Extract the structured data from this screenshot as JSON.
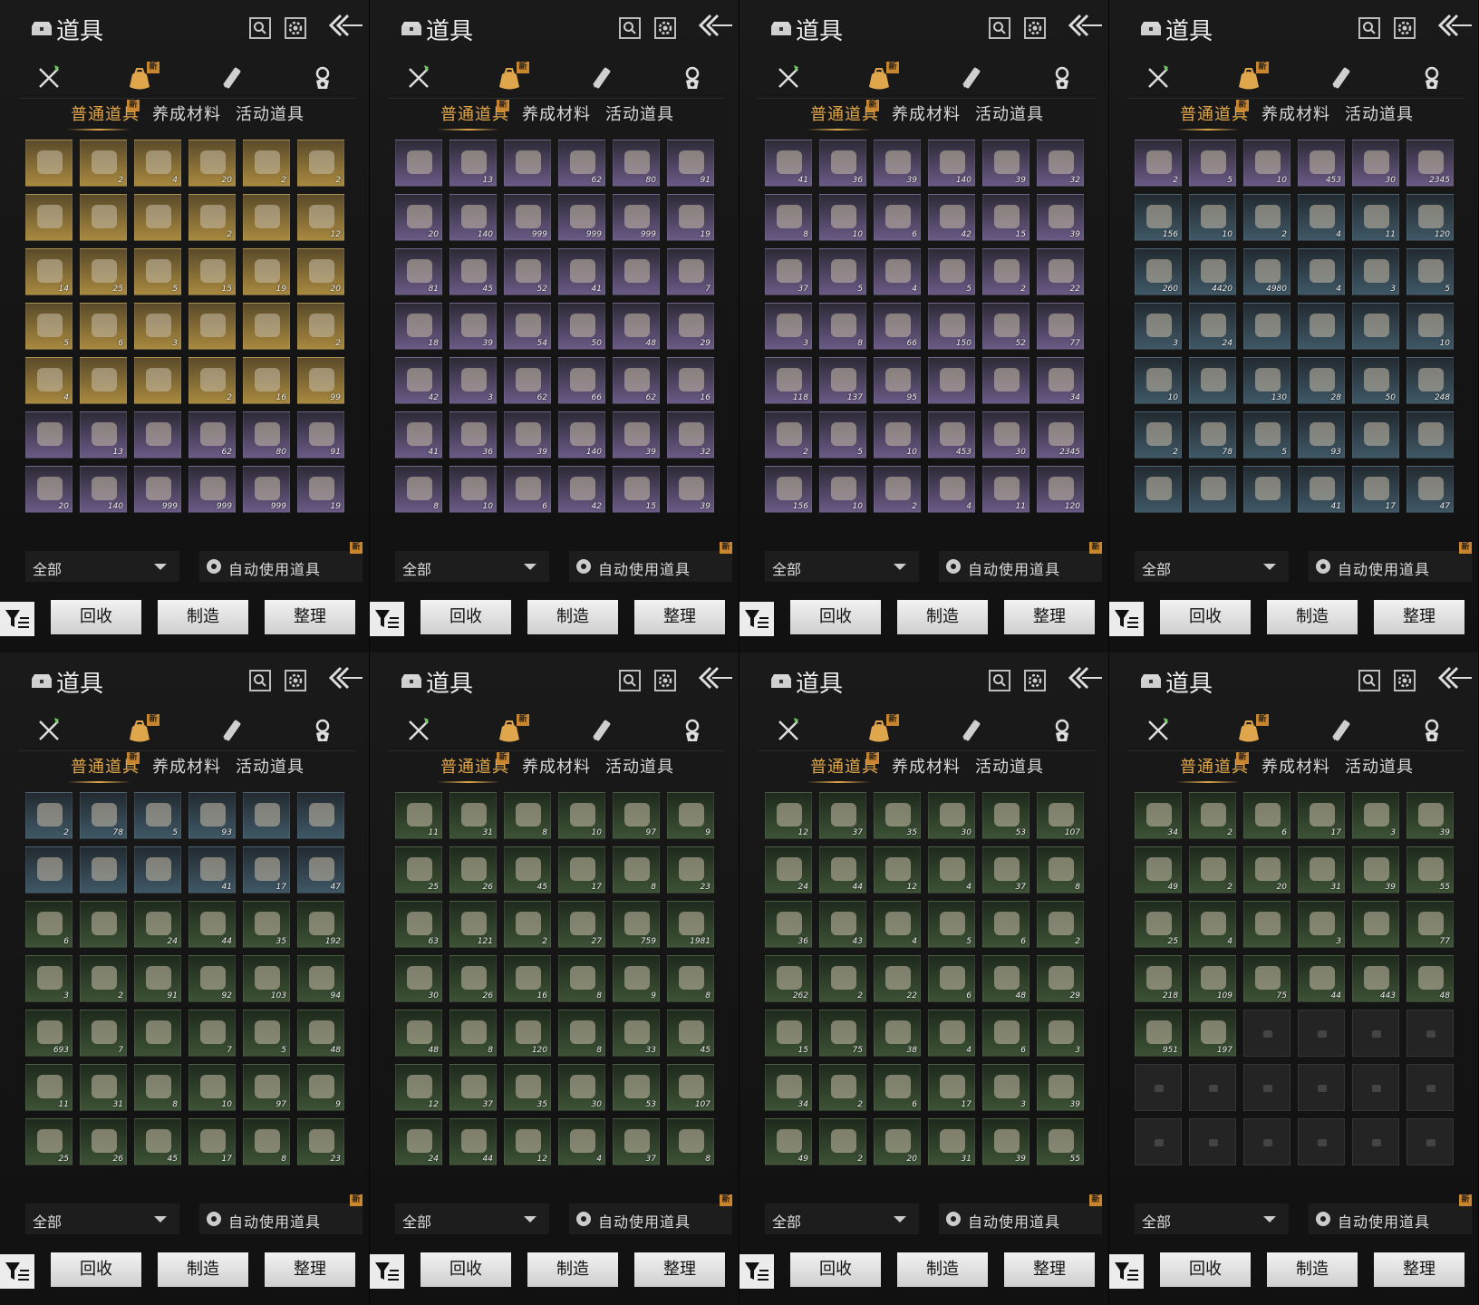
{
  "header": {
    "title": "道具"
  },
  "tabs": [
    {
      "label": "普通道具",
      "badge": "新"
    },
    {
      "label": "养成材料"
    },
    {
      "label": "活动道具"
    }
  ],
  "category_badge": "新",
  "filter": {
    "selected": "全部"
  },
  "auto_use": {
    "label": "自动使用道具",
    "badge": "新"
  },
  "buttons": {
    "recycle": "回收",
    "craft": "制造",
    "sort": "整理"
  },
  "icons": [
    "chest-icon",
    "search-icon",
    "gear-icon",
    "back-arrow-icon",
    "weapon-icon",
    "item-bag-icon",
    "scroll-icon",
    "dungeon-icon",
    "funnel-icon"
  ],
  "panels": [
    {
      "slots": [
        [
          "gold",
          ""
        ],
        [
          "gold",
          "2"
        ],
        [
          "gold",
          "4"
        ],
        [
          "gold",
          "20"
        ],
        [
          "gold",
          "2"
        ],
        [
          "gold",
          "2"
        ],
        [
          "gold",
          ""
        ],
        [
          "gold",
          ""
        ],
        [
          "gold",
          ""
        ],
        [
          "gold",
          "2"
        ],
        [
          "gold",
          ""
        ],
        [
          "gold",
          "12"
        ],
        [
          "gold",
          "14"
        ],
        [
          "gold",
          "25"
        ],
        [
          "gold",
          "5"
        ],
        [
          "gold",
          "15"
        ],
        [
          "gold",
          "19"
        ],
        [
          "gold",
          "20"
        ],
        [
          "gold",
          "5"
        ],
        [
          "gold",
          "6"
        ],
        [
          "gold",
          "3"
        ],
        [
          "gold",
          ""
        ],
        [
          "gold",
          ""
        ],
        [
          "gold",
          "2"
        ],
        [
          "gold",
          "4"
        ],
        [
          "gold",
          ""
        ],
        [
          "gold",
          ""
        ],
        [
          "gold",
          "2"
        ],
        [
          "gold",
          "16"
        ],
        [
          "gold",
          "99"
        ],
        [
          "purple",
          ""
        ],
        [
          "purple",
          "13"
        ],
        [
          "purple",
          ""
        ],
        [
          "purple",
          "62"
        ],
        [
          "purple",
          "80"
        ],
        [
          "purple",
          "91"
        ],
        [
          "purple",
          "20"
        ],
        [
          "purple",
          "140"
        ],
        [
          "purple",
          "999"
        ],
        [
          "purple",
          "999"
        ],
        [
          "purple",
          "999"
        ],
        [
          "purple",
          "19"
        ]
      ]
    },
    {
      "slots": [
        [
          "purple",
          ""
        ],
        [
          "purple",
          "13"
        ],
        [
          "purple",
          ""
        ],
        [
          "purple",
          "62"
        ],
        [
          "purple",
          "80"
        ],
        [
          "purple",
          "91"
        ],
        [
          "purple",
          "20"
        ],
        [
          "purple",
          "140"
        ],
        [
          "purple",
          "999"
        ],
        [
          "purple",
          "999"
        ],
        [
          "purple",
          "999"
        ],
        [
          "purple",
          "19"
        ],
        [
          "purple",
          "81"
        ],
        [
          "purple",
          "45"
        ],
        [
          "purple",
          "52"
        ],
        [
          "purple",
          "41"
        ],
        [
          "purple",
          ""
        ],
        [
          "purple",
          "7"
        ],
        [
          "purple",
          "18"
        ],
        [
          "purple",
          "39"
        ],
        [
          "purple",
          "54"
        ],
        [
          "purple",
          "50"
        ],
        [
          "purple",
          "48"
        ],
        [
          "purple",
          "29"
        ],
        [
          "purple",
          "42"
        ],
        [
          "purple",
          "3"
        ],
        [
          "purple",
          "62"
        ],
        [
          "purple",
          "66"
        ],
        [
          "purple",
          "62"
        ],
        [
          "purple",
          "16"
        ],
        [
          "purple",
          "41"
        ],
        [
          "purple",
          "36"
        ],
        [
          "purple",
          "39"
        ],
        [
          "purple",
          "140"
        ],
        [
          "purple",
          "39"
        ],
        [
          "purple",
          "32"
        ],
        [
          "purple",
          "8"
        ],
        [
          "purple",
          "10"
        ],
        [
          "purple",
          "6"
        ],
        [
          "purple",
          "42"
        ],
        [
          "purple",
          "15"
        ],
        [
          "purple",
          "39"
        ]
      ]
    },
    {
      "slots": [
        [
          "purple",
          "41"
        ],
        [
          "purple",
          "36"
        ],
        [
          "purple",
          "39"
        ],
        [
          "purple",
          "140"
        ],
        [
          "purple",
          "39"
        ],
        [
          "purple",
          "32"
        ],
        [
          "purple",
          "8"
        ],
        [
          "purple",
          "10"
        ],
        [
          "purple",
          "6"
        ],
        [
          "purple",
          "42"
        ],
        [
          "purple",
          "15"
        ],
        [
          "purple",
          "39"
        ],
        [
          "purple",
          "37"
        ],
        [
          "purple",
          "5"
        ],
        [
          "purple",
          "4"
        ],
        [
          "purple",
          "5"
        ],
        [
          "purple",
          "2"
        ],
        [
          "purple",
          "22"
        ],
        [
          "purple",
          "3"
        ],
        [
          "purple",
          "8"
        ],
        [
          "purple",
          "66"
        ],
        [
          "purple",
          "150"
        ],
        [
          "purple",
          "52"
        ],
        [
          "purple",
          "77"
        ],
        [
          "purple",
          "118"
        ],
        [
          "purple",
          "137"
        ],
        [
          "purple",
          "95"
        ],
        [
          "purple",
          ""
        ],
        [
          "purple",
          ""
        ],
        [
          "purple",
          "34"
        ],
        [
          "purple",
          "2"
        ],
        [
          "purple",
          "5"
        ],
        [
          "purple",
          "10"
        ],
        [
          "purple",
          "453"
        ],
        [
          "purple",
          "30"
        ],
        [
          "purple",
          "2345"
        ],
        [
          "purple",
          "156"
        ],
        [
          "purple",
          "10"
        ],
        [
          "purple",
          "2"
        ],
        [
          "purple",
          "4"
        ],
        [
          "purple",
          "11"
        ],
        [
          "purple",
          "120"
        ]
      ]
    },
    {
      "slots": [
        [
          "purple",
          "2"
        ],
        [
          "purple",
          "5"
        ],
        [
          "purple",
          "10"
        ],
        [
          "purple",
          "453"
        ],
        [
          "purple",
          "30"
        ],
        [
          "purple",
          "2345"
        ],
        [
          "blue",
          "156"
        ],
        [
          "blue",
          "10"
        ],
        [
          "blue",
          "2"
        ],
        [
          "blue",
          "4"
        ],
        [
          "blue",
          "11"
        ],
        [
          "blue",
          "120"
        ],
        [
          "blue",
          "260"
        ],
        [
          "blue",
          "4420"
        ],
        [
          "blue",
          "4980"
        ],
        [
          "blue",
          "4"
        ],
        [
          "blue",
          "3"
        ],
        [
          "blue",
          "5"
        ],
        [
          "blue",
          "3"
        ],
        [
          "blue",
          "24"
        ],
        [
          "blue",
          ""
        ],
        [
          "blue",
          ""
        ],
        [
          "blue",
          ""
        ],
        [
          "blue",
          "10"
        ],
        [
          "blue",
          "10"
        ],
        [
          "blue",
          ""
        ],
        [
          "blue",
          "130"
        ],
        [
          "blue",
          "28"
        ],
        [
          "blue",
          "50"
        ],
        [
          "blue",
          "248"
        ],
        [
          "blue",
          "2"
        ],
        [
          "blue",
          "78"
        ],
        [
          "blue",
          "5"
        ],
        [
          "blue",
          "93"
        ],
        [
          "blue",
          ""
        ],
        [
          "blue",
          ""
        ],
        [
          "blue",
          ""
        ],
        [
          "blue",
          ""
        ],
        [
          "blue",
          ""
        ],
        [
          "blue",
          "41"
        ],
        [
          "blue",
          "17"
        ],
        [
          "blue",
          "47"
        ]
      ]
    },
    {
      "slots": [
        [
          "blue",
          "2"
        ],
        [
          "blue",
          "78"
        ],
        [
          "blue",
          "5"
        ],
        [
          "blue",
          "93"
        ],
        [
          "blue",
          ""
        ],
        [
          "blue",
          ""
        ],
        [
          "blue",
          ""
        ],
        [
          "blue",
          ""
        ],
        [
          "blue",
          ""
        ],
        [
          "blue",
          "41"
        ],
        [
          "blue",
          "17"
        ],
        [
          "blue",
          "47"
        ],
        [
          "green",
          "6"
        ],
        [
          "green",
          ""
        ],
        [
          "green",
          "24"
        ],
        [
          "green",
          "44"
        ],
        [
          "green",
          "35"
        ],
        [
          "green",
          "192"
        ],
        [
          "green",
          "3"
        ],
        [
          "green",
          "2"
        ],
        [
          "green",
          "91"
        ],
        [
          "green",
          "92"
        ],
        [
          "green",
          "103"
        ],
        [
          "green",
          "94"
        ],
        [
          "green",
          "693"
        ],
        [
          "green",
          "7"
        ],
        [
          "green",
          ""
        ],
        [
          "green",
          "7"
        ],
        [
          "green",
          "5"
        ],
        [
          "green",
          "48"
        ],
        [
          "green",
          "11"
        ],
        [
          "green",
          "31"
        ],
        [
          "green",
          "8"
        ],
        [
          "green",
          "10"
        ],
        [
          "green",
          "97"
        ],
        [
          "green",
          "9"
        ],
        [
          "green",
          "25"
        ],
        [
          "green",
          "26"
        ],
        [
          "green",
          "45"
        ],
        [
          "green",
          "17"
        ],
        [
          "green",
          "8"
        ],
        [
          "green",
          "23"
        ]
      ]
    },
    {
      "slots": [
        [
          "green",
          "11"
        ],
        [
          "green",
          "31"
        ],
        [
          "green",
          "8"
        ],
        [
          "green",
          "10"
        ],
        [
          "green",
          "97"
        ],
        [
          "green",
          "9"
        ],
        [
          "green",
          "25"
        ],
        [
          "green",
          "26"
        ],
        [
          "green",
          "45"
        ],
        [
          "green",
          "17"
        ],
        [
          "green",
          "8"
        ],
        [
          "green",
          "23"
        ],
        [
          "green",
          "63"
        ],
        [
          "green",
          "121"
        ],
        [
          "green",
          "2"
        ],
        [
          "green",
          "27"
        ],
        [
          "green",
          "759"
        ],
        [
          "green",
          "1981"
        ],
        [
          "green",
          "30"
        ],
        [
          "green",
          "26"
        ],
        [
          "green",
          "16"
        ],
        [
          "green",
          "8"
        ],
        [
          "green",
          "9"
        ],
        [
          "green",
          "8"
        ],
        [
          "green",
          "48"
        ],
        [
          "green",
          "8"
        ],
        [
          "green",
          "120"
        ],
        [
          "green",
          "8"
        ],
        [
          "green",
          "33"
        ],
        [
          "green",
          "45"
        ],
        [
          "green",
          "12"
        ],
        [
          "green",
          "37"
        ],
        [
          "green",
          "35"
        ],
        [
          "green",
          "30"
        ],
        [
          "green",
          "53"
        ],
        [
          "green",
          "107"
        ],
        [
          "green",
          "24"
        ],
        [
          "green",
          "44"
        ],
        [
          "green",
          "12"
        ],
        [
          "green",
          "4"
        ],
        [
          "green",
          "37"
        ],
        [
          "green",
          "8"
        ]
      ]
    },
    {
      "slots": [
        [
          "green",
          "12"
        ],
        [
          "green",
          "37"
        ],
        [
          "green",
          "35"
        ],
        [
          "green",
          "30"
        ],
        [
          "green",
          "53"
        ],
        [
          "green",
          "107"
        ],
        [
          "green",
          "24"
        ],
        [
          "green",
          "44"
        ],
        [
          "green",
          "12"
        ],
        [
          "green",
          "4"
        ],
        [
          "green",
          "37"
        ],
        [
          "green",
          "8"
        ],
        [
          "green",
          "36"
        ],
        [
          "green",
          "43"
        ],
        [
          "green",
          "4"
        ],
        [
          "green",
          "5"
        ],
        [
          "green",
          "6"
        ],
        [
          "green",
          "2"
        ],
        [
          "green",
          "262"
        ],
        [
          "green",
          "2"
        ],
        [
          "green",
          "22"
        ],
        [
          "green",
          "6"
        ],
        [
          "green",
          "48"
        ],
        [
          "green",
          "29"
        ],
        [
          "green",
          "15"
        ],
        [
          "green",
          "75"
        ],
        [
          "green",
          "38"
        ],
        [
          "green",
          "4"
        ],
        [
          "green",
          "6"
        ],
        [
          "green",
          "3"
        ],
        [
          "green",
          "34"
        ],
        [
          "green",
          "2"
        ],
        [
          "green",
          "6"
        ],
        [
          "green",
          "17"
        ],
        [
          "green",
          "3"
        ],
        [
          "green",
          "39"
        ],
        [
          "green",
          "49"
        ],
        [
          "green",
          "2"
        ],
        [
          "green",
          "20"
        ],
        [
          "green",
          "31"
        ],
        [
          "green",
          "39"
        ],
        [
          "green",
          "55"
        ]
      ]
    },
    {
      "slots": [
        [
          "green",
          "34"
        ],
        [
          "green",
          "2"
        ],
        [
          "green",
          "6"
        ],
        [
          "green",
          "17"
        ],
        [
          "green",
          "3"
        ],
        [
          "green",
          "39"
        ],
        [
          "green",
          "49"
        ],
        [
          "green",
          "2"
        ],
        [
          "green",
          "20"
        ],
        [
          "green",
          "31"
        ],
        [
          "green",
          "39"
        ],
        [
          "green",
          "55"
        ],
        [
          "green",
          "25"
        ],
        [
          "green",
          "4"
        ],
        [
          "green",
          ""
        ],
        [
          "green",
          "3"
        ],
        [
          "green",
          ""
        ],
        [
          "green",
          "77"
        ],
        [
          "green",
          "218"
        ],
        [
          "green",
          "109"
        ],
        [
          "green",
          "75"
        ],
        [
          "green",
          "44"
        ],
        [
          "green",
          "443"
        ],
        [
          "green",
          "48"
        ],
        [
          "green",
          "951"
        ],
        [
          "green",
          "197"
        ],
        [
          "empty",
          ""
        ],
        [
          "empty",
          ""
        ],
        [
          "empty",
          ""
        ],
        [
          "empty",
          ""
        ],
        [
          "empty",
          ""
        ],
        [
          "empty",
          ""
        ],
        [
          "empty",
          ""
        ],
        [
          "empty",
          ""
        ],
        [
          "empty",
          ""
        ],
        [
          "empty",
          ""
        ],
        [
          "empty",
          ""
        ],
        [
          "empty",
          ""
        ],
        [
          "empty",
          ""
        ],
        [
          "empty",
          ""
        ],
        [
          "empty",
          ""
        ],
        [
          "empty",
          ""
        ]
      ]
    }
  ]
}
